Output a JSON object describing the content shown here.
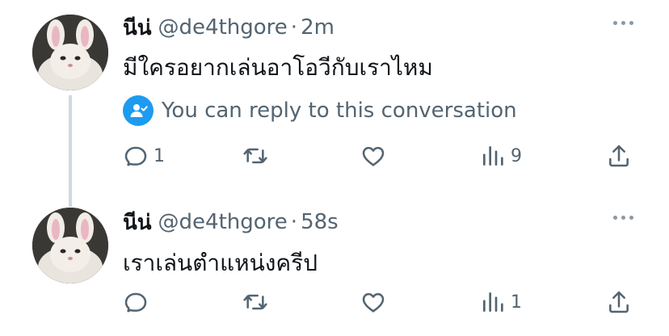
{
  "tweets": [
    {
      "author": {
        "name": "นีน่",
        "handle": "@de4thgore"
      },
      "separator": "·",
      "time": "2m",
      "text": "มีใครอยากเล่นอาโอวีกับเราไหม",
      "reply_notice": "You can reply to this conversation",
      "actions": {
        "reply_count": "1",
        "retweet_count": "",
        "like_count": "",
        "view_count": "9"
      }
    },
    {
      "author": {
        "name": "นีน่",
        "handle": "@de4thgore"
      },
      "separator": "·",
      "time": "58s",
      "text": "เราเล่นตำแหน่งครีป",
      "actions": {
        "reply_count": "",
        "retweet_count": "",
        "like_count": "",
        "view_count": "1"
      }
    }
  ],
  "colors": {
    "text": "#0f1419",
    "secondary": "#536471",
    "accent": "#1d9bf0",
    "thread_line": "#cfd9de"
  },
  "icons": [
    "reply-icon",
    "retweet-icon",
    "like-icon",
    "views-icon",
    "share-icon",
    "more-icon",
    "user-reply-icon"
  ]
}
